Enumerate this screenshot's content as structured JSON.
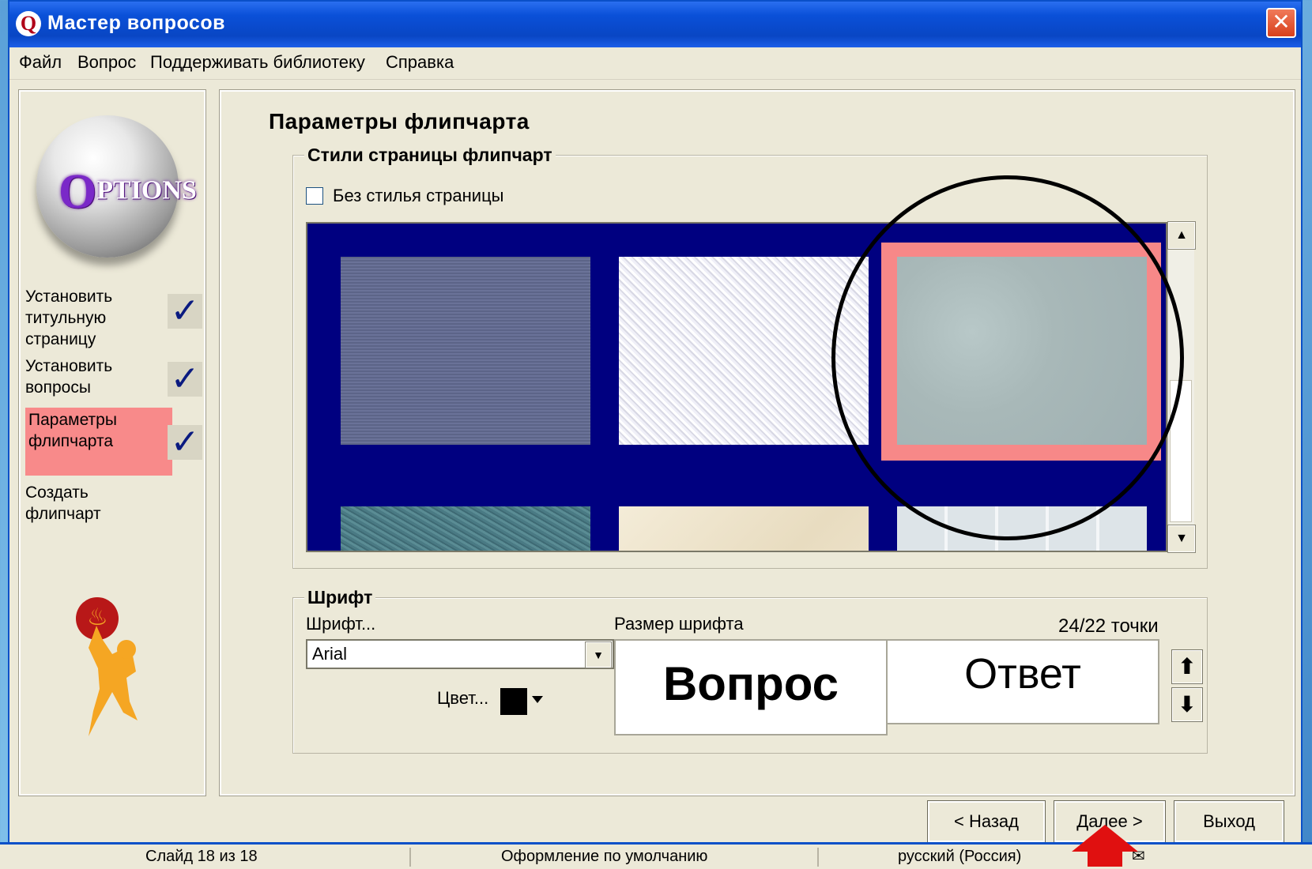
{
  "window": {
    "title": "Мастер вопросов",
    "close_label": "✕"
  },
  "menu": [
    "Файл",
    "Вопрос",
    "Поддерживать библиотеку",
    "Справка"
  ],
  "logo_text": "PTIONS",
  "logo_o": "O",
  "steps": [
    {
      "label": "Установить титульную страницу",
      "done": true
    },
    {
      "label": "Установить вопросы",
      "done": true
    },
    {
      "label": "Параметры флипчарта",
      "done": true,
      "active": true
    },
    {
      "label": "Создать флипчарт",
      "done": false
    }
  ],
  "check_glyph": "✓",
  "main": {
    "title": "Параметры флипчарта",
    "page_styles": {
      "legend": "Стили страницы флипчарт",
      "no_style_label": "Без стилья страницы",
      "no_style_checked": false,
      "selected_index": 2
    },
    "font": {
      "legend": "Шрифт",
      "font_label": "Шрифт...",
      "font_value": "Arial",
      "color_label": "Цвет...",
      "color_value": "#000000",
      "size_label": "Размер шрифта",
      "size_value": "24/22 точки",
      "preview_question": "Вопрос",
      "preview_answer": "Ответ"
    }
  },
  "buttons": {
    "back": "< Назад",
    "next": "Далее >",
    "exit": "Выход"
  },
  "status": {
    "slide": "Слайд 18 из 18",
    "theme": "Оформление по умолчанию",
    "language": "русский (Россия)"
  },
  "accent": {
    "selected_tile_border": "#f78888",
    "active_step_bg": "#f88a8a",
    "gallery_bg": "#000080",
    "pointer_arrow": "#e01010"
  }
}
